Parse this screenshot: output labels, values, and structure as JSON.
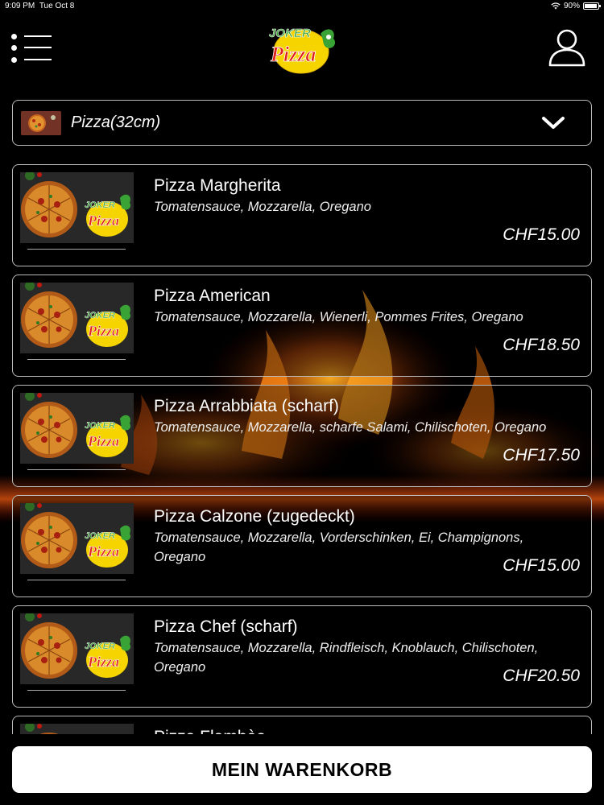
{
  "status_bar": {
    "time": "9:09 PM",
    "date": "Tue Oct 8",
    "battery": "90%"
  },
  "header": {
    "menu_icon": "hamburger-menu-icon",
    "logo_text_top": "JOKER",
    "logo_text_bottom": "Pizza",
    "user_icon": "user-icon"
  },
  "category": {
    "label": "Pizza(32cm)",
    "icon": "chevron-down-icon"
  },
  "items": [
    {
      "title": "Pizza Margherita",
      "desc": "Tomatensauce, Mozzarella, Oregano",
      "price": "CHF15.00"
    },
    {
      "title": "Pizza American",
      "desc": "Tomatensauce, Mozzarella, Wienerli, Pommes Frites, Oregano",
      "price": "CHF18.50"
    },
    {
      "title": "Pizza Arrabbiata (scharf)",
      "desc": "Tomatensauce, Mozzarella, scharfe Salami, Chilischoten, Oregano",
      "price": "CHF17.50"
    },
    {
      "title": "Pizza Calzone (zugedeckt)",
      "desc": "Tomatensauce, Mozzarella, Vorderschinken, Ei, Champignons, Oregano",
      "price": "CHF15.00"
    },
    {
      "title": "Pizza Chef (scharf)",
      "desc": "Tomatensauce, Mozzarella, Rindfleisch, Knoblauch, Chilischoten, Oregano",
      "price": "CHF20.50"
    },
    {
      "title": "Pizza Flambèe",
      "desc": "",
      "price": ""
    }
  ],
  "cart": {
    "label": "MEIN WARENKORB"
  },
  "colors": {
    "background": "#000000",
    "logo_yellow": "#f5d400",
    "logo_red": "#e0201b",
    "logo_green": "#3aa335"
  }
}
